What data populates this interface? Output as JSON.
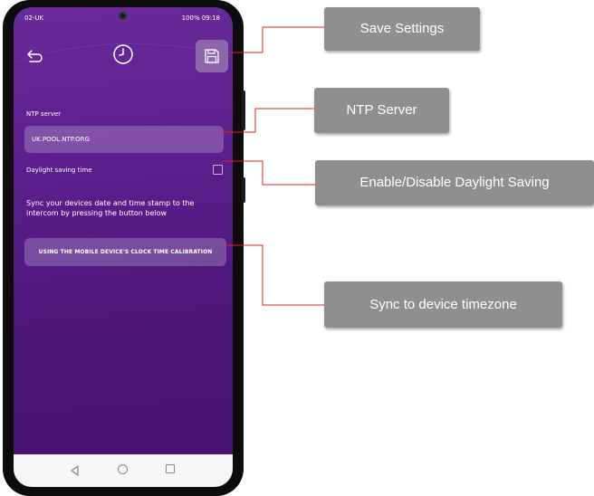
{
  "status_bar": {
    "left": "02-UK",
    "right": "100% 09:18"
  },
  "icons": {
    "back": "back-arrow-icon",
    "clock": "clock-icon",
    "save": "floppy-disk-icon"
  },
  "form": {
    "ntp_label": "NTP server",
    "ntp_value": "UK.POOL.NTP.ORG",
    "dst_label": "Daylight saving time",
    "dst_checked": false,
    "sync_text": "Sync your devices date and time stamp to the intercom by pressing the button below",
    "sync_button": "USING THE MOBILE DEVICE'S CLOCK TIME CALIBRATION"
  },
  "callouts": {
    "save": "Save Settings",
    "ntp": "NTP Server",
    "dst": "Enable/Disable Daylight Saving",
    "sync": "Sync to device timezone"
  },
  "colors": {
    "screen_bg": "#5a1f8c",
    "callout_bg": "#8f8f8f",
    "connector": "#e02020"
  }
}
